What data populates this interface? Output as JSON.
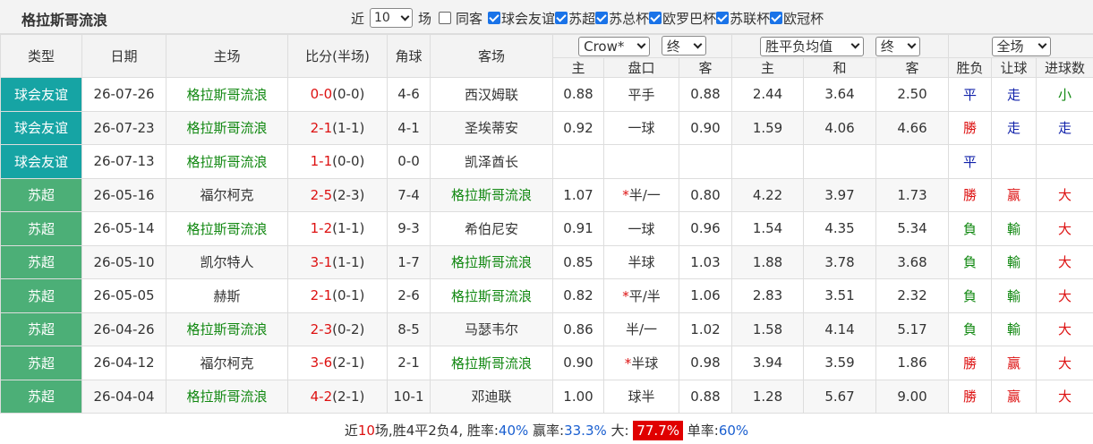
{
  "header": {
    "team_title": "格拉斯哥流浪",
    "recent_label": "近",
    "recent_count": "10",
    "games_label": "场",
    "same_guest_label": "同客",
    "competitions": [
      "球会友谊",
      "苏超",
      "苏总杯",
      "欧罗巴杯",
      "苏联杯",
      "欧冠杯"
    ]
  },
  "columns": {
    "type": "类型",
    "date": "日期",
    "home": "主场",
    "score": "比分(半场)",
    "corner": "角球",
    "away": "客场",
    "handicap_company": "Crow*",
    "handicap_stage": "终",
    "europe_type": "胜平负均值",
    "europe_stage": "终",
    "scope": "全场",
    "sub_home": "主",
    "sub_line": "盘口",
    "sub_away": "客",
    "sub_e_home": "主",
    "sub_draw": "和",
    "sub_e_away": "客",
    "result": "胜负",
    "handicap_result": "让球",
    "goals": "进球数"
  },
  "matches": [
    {
      "type": "球会友谊",
      "date": "26-07-26",
      "home": "格拉斯哥流浪",
      "ft": "0-0",
      "ht": "(0-0)",
      "corner": "4-6",
      "away": "西汉姆联",
      "h_home": "0.88",
      "h_line": "平手",
      "h_away": "0.88",
      "e_home": "2.44",
      "e_draw": "3.64",
      "e_away": "2.50",
      "res": "平",
      "hres": "走",
      "goals": "小"
    },
    {
      "type": "球会友谊",
      "date": "26-07-23",
      "home": "格拉斯哥流浪",
      "ft": "2-1",
      "ht": "(1-1)",
      "corner": "4-1",
      "away": "圣埃蒂安",
      "h_home": "0.92",
      "h_line": "一球",
      "h_away": "0.90",
      "e_home": "1.59",
      "e_draw": "4.06",
      "e_away": "4.66",
      "res": "勝",
      "hres": "走",
      "goals": "走"
    },
    {
      "type": "球会友谊",
      "date": "26-07-13",
      "home": "格拉斯哥流浪",
      "ft": "1-1",
      "ht": "(0-0)",
      "corner": "0-0",
      "away": "凯泽酋长",
      "h_home": "",
      "h_line": "",
      "h_away": "",
      "e_home": "",
      "e_draw": "",
      "e_away": "",
      "res": "平",
      "hres": "",
      "goals": ""
    },
    {
      "type": "苏超",
      "date": "26-05-16",
      "home": "福尔柯克",
      "ft": "2-5",
      "ht": "(2-3)",
      "corner": "7-4",
      "away": "格拉斯哥流浪",
      "h_home": "1.07",
      "h_line_star": "*",
      "h_line": "半/一",
      "h_away": "0.80",
      "e_home": "4.22",
      "e_draw": "3.97",
      "e_away": "1.73",
      "res": "勝",
      "hres": "赢",
      "goals": "大"
    },
    {
      "type": "苏超",
      "date": "26-05-14",
      "home": "格拉斯哥流浪",
      "ft": "1-2",
      "ht": "(1-1)",
      "corner": "9-3",
      "away": "希伯尼安",
      "h_home": "0.91",
      "h_line": "一球",
      "h_away": "0.96",
      "e_home": "1.54",
      "e_draw": "4.35",
      "e_away": "5.34",
      "res": "負",
      "hres": "輸",
      "goals": "大"
    },
    {
      "type": "苏超",
      "date": "26-05-10",
      "home": "凯尔特人",
      "ft": "3-1",
      "ht": "(1-1)",
      "corner": "1-7",
      "away": "格拉斯哥流浪",
      "h_home": "0.85",
      "h_line": "半球",
      "h_away": "1.03",
      "e_home": "1.88",
      "e_draw": "3.78",
      "e_away": "3.68",
      "res": "負",
      "hres": "輸",
      "goals": "大"
    },
    {
      "type": "苏超",
      "date": "26-05-05",
      "home": "赫斯",
      "ft": "2-1",
      "ht": "(0-1)",
      "corner": "2-6",
      "away": "格拉斯哥流浪",
      "h_home": "0.82",
      "h_line_star": "*",
      "h_line": "平/半",
      "h_away": "1.06",
      "e_home": "2.83",
      "e_draw": "3.51",
      "e_away": "2.32",
      "res": "負",
      "hres": "輸",
      "goals": "大"
    },
    {
      "type": "苏超",
      "date": "26-04-26",
      "home": "格拉斯哥流浪",
      "ft": "2-3",
      "ht": "(0-2)",
      "corner": "8-5",
      "away": "马瑟韦尔",
      "h_home": "0.86",
      "h_line": "半/一",
      "h_away": "1.02",
      "e_home": "1.58",
      "e_draw": "4.14",
      "e_away": "5.17",
      "res": "負",
      "hres": "輸",
      "goals": "大"
    },
    {
      "type": "苏超",
      "date": "26-04-12",
      "home": "福尔柯克",
      "ft": "3-6",
      "ht": "(2-1)",
      "corner": "2-1",
      "away": "格拉斯哥流浪",
      "h_home": "0.90",
      "h_line_star": "*",
      "h_line": "半球",
      "h_away": "0.98",
      "e_home": "3.94",
      "e_draw": "3.59",
      "e_away": "1.86",
      "res": "勝",
      "hres": "赢",
      "goals": "大"
    },
    {
      "type": "苏超",
      "date": "26-04-04",
      "home": "格拉斯哥流浪",
      "ft": "4-2",
      "ht": "(2-1)",
      "corner": "10-1",
      "away": "邓迪联",
      "h_home": "1.00",
      "h_line": "球半",
      "h_away": "0.88",
      "e_home": "1.28",
      "e_draw": "5.67",
      "e_away": "9.00",
      "res": "勝",
      "hres": "赢",
      "goals": "大"
    }
  ],
  "summary": {
    "prefix": "近",
    "count": "10",
    "record": "场,胜4平2负4, 胜率:",
    "win_rate": "40%",
    "handicap_label": " 赢率:",
    "handicap_rate": "33.3%",
    "big_label": " 大: ",
    "big_rate": "77.7%",
    "single_label": " 单率:",
    "single_rate": "60%"
  },
  "colors": {
    "friendly": "#16a4a4",
    "league": "#4caf77",
    "team_green": "#118811",
    "score_red": "#dd1111",
    "hl_red": "#e00000"
  }
}
